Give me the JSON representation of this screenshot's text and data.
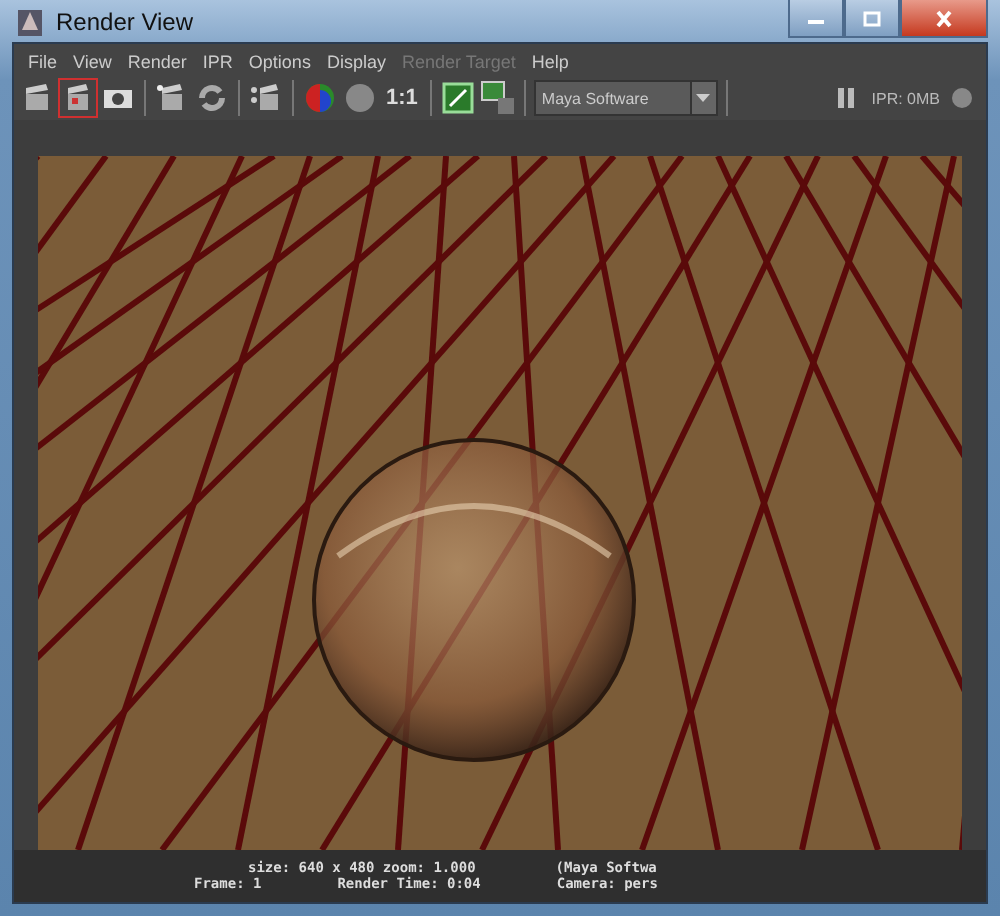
{
  "window": {
    "title": "Render View"
  },
  "menu": [
    {
      "label": "File",
      "disabled": false
    },
    {
      "label": "View",
      "disabled": false
    },
    {
      "label": "Render",
      "disabled": false
    },
    {
      "label": "IPR",
      "disabled": false
    },
    {
      "label": "Options",
      "disabled": false
    },
    {
      "label": "Display",
      "disabled": false
    },
    {
      "label": "Render Target",
      "disabled": true
    },
    {
      "label": "Help",
      "disabled": false
    }
  ],
  "tools": [
    {
      "selected": false
    },
    {
      "selected": true
    },
    {
      "selected": false
    },
    {
      "selected": false
    },
    {
      "selected": false
    },
    {
      "selected": false
    },
    {
      "selected": false
    },
    {
      "selected": false
    }
  ],
  "toolbar": {
    "zoom_label": "1:1",
    "renderer": "Maya Software",
    "ipr_label": "IPR: 0MB"
  },
  "status_bar": {
    "line_1": [
      "size: 640 x 480 zoom: 1.000",
      "(Maya Softwa"
    ],
    "line_2": [
      "Frame: 1",
      "Render Time: 0:04",
      "Camera: pers"
    ]
  }
}
